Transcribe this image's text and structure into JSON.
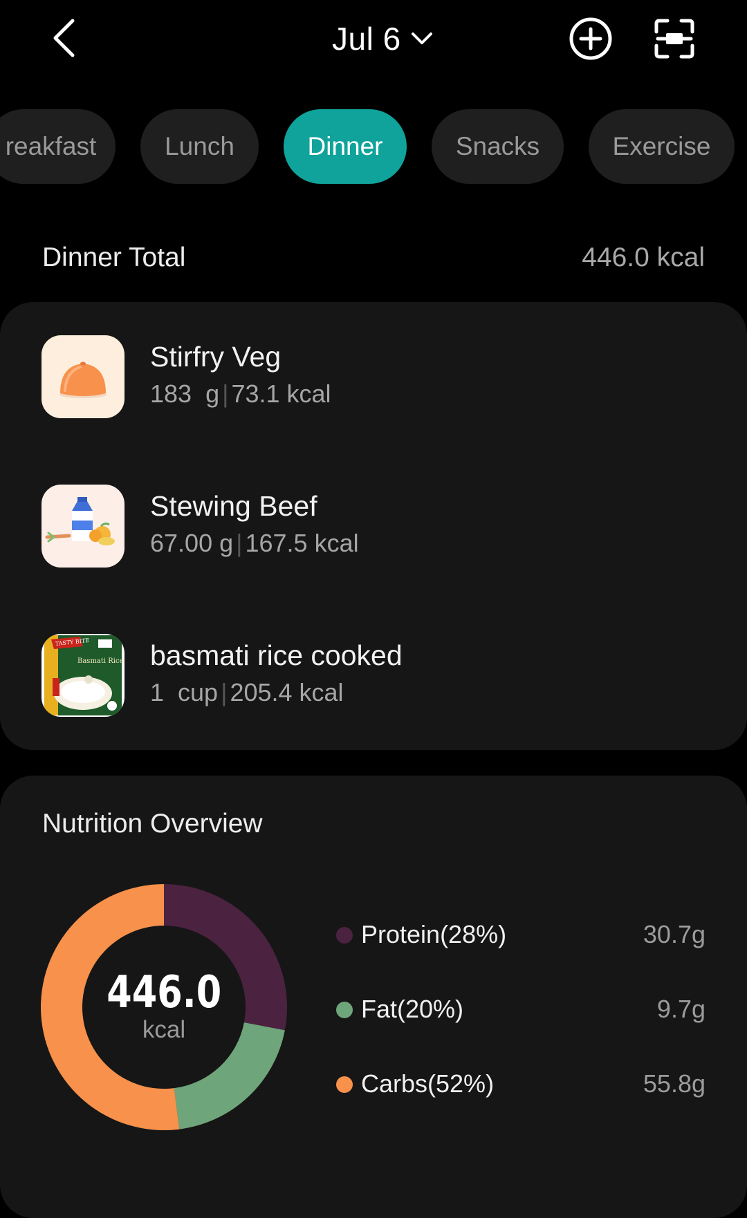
{
  "header": {
    "date": "Jul 6"
  },
  "tabs": [
    {
      "label": "reakfast",
      "active": false
    },
    {
      "label": "Lunch",
      "active": false
    },
    {
      "label": "Dinner",
      "active": true
    },
    {
      "label": "Snacks",
      "active": false
    },
    {
      "label": "Exercise",
      "active": false
    }
  ],
  "summary": {
    "label": "Dinner Total",
    "value": "446.0 kcal"
  },
  "foods": [
    {
      "name": "Stirfry Veg",
      "amount": "183  g",
      "kcal": "73.1 kcal",
      "icon": "orange-dome-icon"
    },
    {
      "name": "Stewing Beef",
      "amount": "67.00 g",
      "kcal": "167.5 kcal",
      "icon": "grocery-milk-vegetables-icon"
    },
    {
      "name": "basmati rice cooked",
      "amount": "1  cup",
      "kcal": "205.4 kcal",
      "icon": "rice-package-photo"
    }
  ],
  "nutrition": {
    "title": "Nutrition Overview",
    "total_value": "446.0",
    "total_unit": "kcal",
    "macros": [
      {
        "label": "Protein(28%)",
        "value": "30.7g",
        "percent": 28,
        "color": "#4b2340"
      },
      {
        "label": "Fat(20%)",
        "value": "9.7g",
        "percent": 20,
        "color": "#6fa57a"
      },
      {
        "label": "Carbs(52%)",
        "value": "55.8g",
        "percent": 52,
        "color": "#f7914b"
      }
    ]
  },
  "colors": {
    "accent": "#10a39b",
    "background": "#000000",
    "card": "#161616"
  }
}
